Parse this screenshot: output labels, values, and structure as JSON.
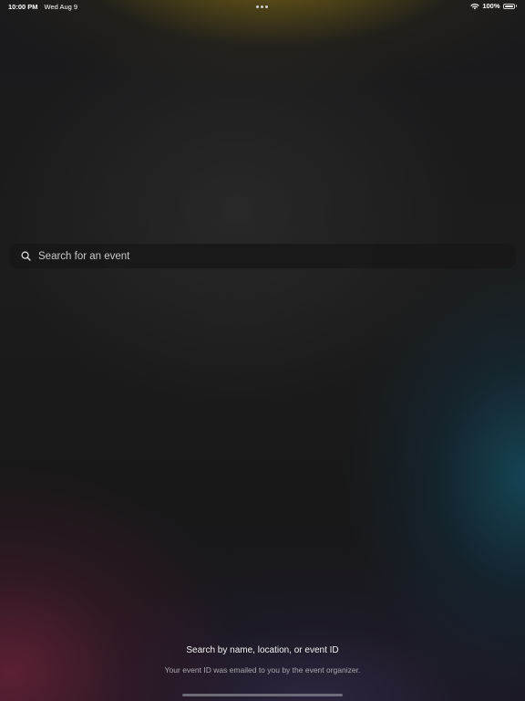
{
  "status_bar": {
    "time": "10:00 PM",
    "date": "Wed Aug 9",
    "battery": "100%",
    "battery_level": 1.0,
    "icons": [
      "more-dots-icon",
      "wifi-icon",
      "battery-icon"
    ]
  },
  "search": {
    "placeholder": "Search for an event",
    "value": "",
    "icon": "search-icon"
  },
  "hint": {
    "title": "Search by name, location, or event ID",
    "subtitle": "Your event ID was emailed to you by the event organizer."
  },
  "colors": {
    "background": "#1a1a1a",
    "text_primary": "#ffffff",
    "text_secondary": "#a9a9ad",
    "placeholder": "#c9c9c9"
  }
}
